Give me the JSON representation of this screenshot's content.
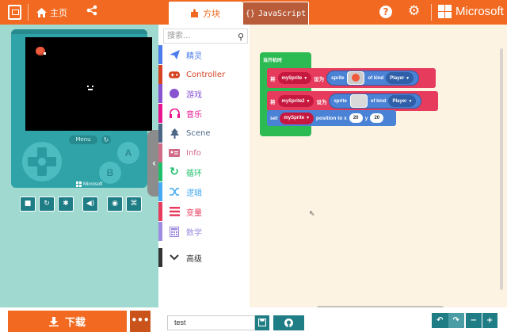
{
  "header": {
    "home_label": "主页",
    "tabs": [
      {
        "label": "方块",
        "icon": "puzzle-icon"
      },
      {
        "label": "JavaScript",
        "icon": "braces-icon",
        "glyph": "{}"
      }
    ],
    "brand": "Microsoft",
    "help_glyph": "?"
  },
  "simulator": {
    "menu_label": "Menu",
    "button_a": "A",
    "button_b": "B",
    "console_brand": "Microsoft",
    "toolbar": [
      "stop-icon",
      "restart-icon",
      "debug-icon",
      "sound-icon",
      "screenshot-icon",
      "keyboard-icon"
    ]
  },
  "download": {
    "label": "下载",
    "more": "•••"
  },
  "toolbox": {
    "search_placeholder": "搜索...",
    "categories": [
      {
        "label": "精灵",
        "color": "#4b7bec",
        "icon": "paper-plane-icon"
      },
      {
        "label": "Controller",
        "color": "#d54322",
        "icon": "gamepad-icon"
      },
      {
        "label": "游戏",
        "color": "#8854d0",
        "icon": "circle-icon"
      },
      {
        "label": "音乐",
        "color": "#e8138f",
        "icon": "headphones-icon"
      },
      {
        "label": "Scene",
        "color": "#4b6584",
        "icon": "tree-icon"
      },
      {
        "label": "Info",
        "color": "#cf6a87",
        "icon": "id-card-icon"
      },
      {
        "label": "循环",
        "color": "#20bf6b",
        "icon": "loop-icon"
      },
      {
        "label": "逻辑",
        "color": "#45aaf2",
        "icon": "shuffle-icon"
      },
      {
        "label": "变量",
        "color": "#e63b5c",
        "icon": "list-icon"
      },
      {
        "label": "数学",
        "color": "#9f8be0",
        "icon": "calculator-icon"
      },
      {
        "label": "高级",
        "color": "#333333",
        "icon": "chevron-down-icon"
      }
    ]
  },
  "blocks": {
    "on_start": "当开机时",
    "stmt1": {
      "set": "将",
      "var": "mySprite",
      "to": "设为",
      "fn": "sprite",
      "of_kind": "of kind",
      "kind": "Player"
    },
    "stmt2": {
      "set": "将",
      "var": "mySprite2",
      "to": "设为",
      "fn": "sprite",
      "of_kind": "of kind",
      "kind": "Player"
    },
    "stmt3": {
      "set": "set",
      "var": "mySprite",
      "prop": "position to x",
      "x": "20",
      "y_label": "y",
      "y": "20"
    }
  },
  "bottom": {
    "project_name": "test",
    "zoom_out": "−",
    "zoom_in": "+"
  },
  "colors": {
    "accent": "#f26a21",
    "sim_bg": "#9fd9cf",
    "console": "#2fa3a8",
    "workspace_bg": "#fdf3e3",
    "teal_btn": "#1f7d86"
  }
}
